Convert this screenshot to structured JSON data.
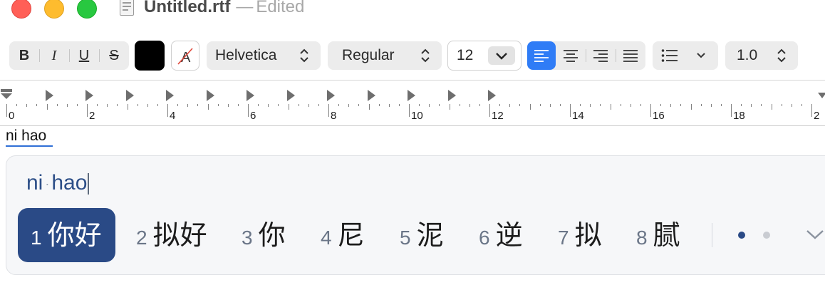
{
  "window": {
    "title": "Untitled.rtf",
    "separator": "—",
    "status": "Edited"
  },
  "toolbar": {
    "bold_label": "B",
    "italic_label": "I",
    "underline_label": "U",
    "strike_label": "S",
    "text_color": "#000000",
    "font_family": "Helvetica",
    "font_style": "Regular",
    "font_size": "12",
    "alignment": "left",
    "line_spacing": "1.0",
    "accent_color": "#2f7cf6"
  },
  "ruler": {
    "numbers": [
      "0",
      "2",
      "4",
      "6",
      "8",
      "10",
      "12",
      "14",
      "16",
      "18",
      "2"
    ]
  },
  "document": {
    "text": "ni hao"
  },
  "ime": {
    "preedit": [
      "ni",
      "hao"
    ],
    "candidates": [
      {
        "num": "1",
        "text": "你好",
        "selected": true
      },
      {
        "num": "2",
        "text": "拟好"
      },
      {
        "num": "3",
        "text": "你"
      },
      {
        "num": "4",
        "text": "尼"
      },
      {
        "num": "5",
        "text": "泥"
      },
      {
        "num": "6",
        "text": "逆"
      },
      {
        "num": "7",
        "text": "拟"
      },
      {
        "num": "8",
        "text": "腻"
      }
    ],
    "page_indicator": {
      "current": 1,
      "total": 2
    },
    "selected_color": "#2a4a86"
  }
}
